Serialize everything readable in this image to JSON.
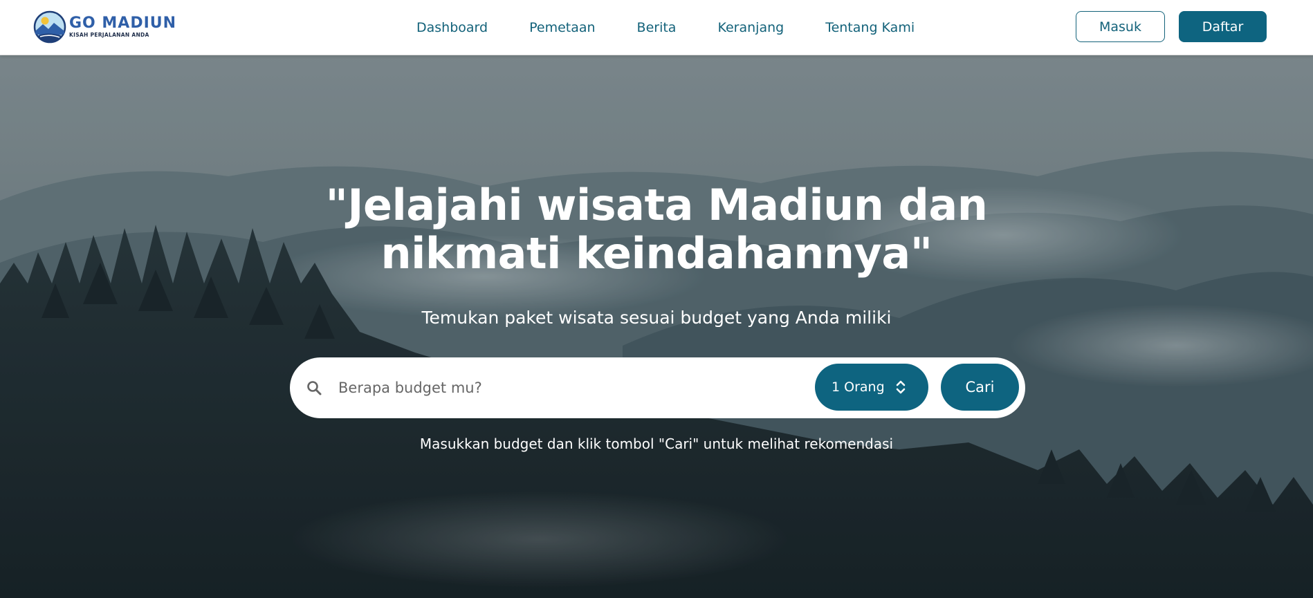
{
  "brand": {
    "title": "GO MADIUN",
    "tagline": "KISAH PERJALANAN ANDA"
  },
  "nav": {
    "items": [
      {
        "label": "Dashboard"
      },
      {
        "label": "Pemetaan"
      },
      {
        "label": "Berita"
      },
      {
        "label": "Keranjang"
      },
      {
        "label": "Tentang Kami"
      }
    ]
  },
  "auth": {
    "login_label": "Masuk",
    "register_label": "Daftar"
  },
  "hero": {
    "title": "\"Jelajahi wisata Madiun dan nikmati keindahannya\"",
    "subtitle": "Temukan paket wisata sesuai budget yang Anda miliki",
    "search_placeholder": "Berapa budget mu?",
    "search_value": "",
    "people_selected": "1 Orang",
    "search_button": "Cari",
    "hint": "Masukkan budget dan klik tombol \"Cari\" untuk melihat rekomendasi"
  },
  "colors": {
    "primary": "#0e6480",
    "nav_text": "#13627a",
    "logo_blue": "#2f5fa8"
  },
  "icons": {
    "logo": "go-madiun-logo-icon",
    "search": "search-icon",
    "select": "updown-chevron-icon"
  }
}
